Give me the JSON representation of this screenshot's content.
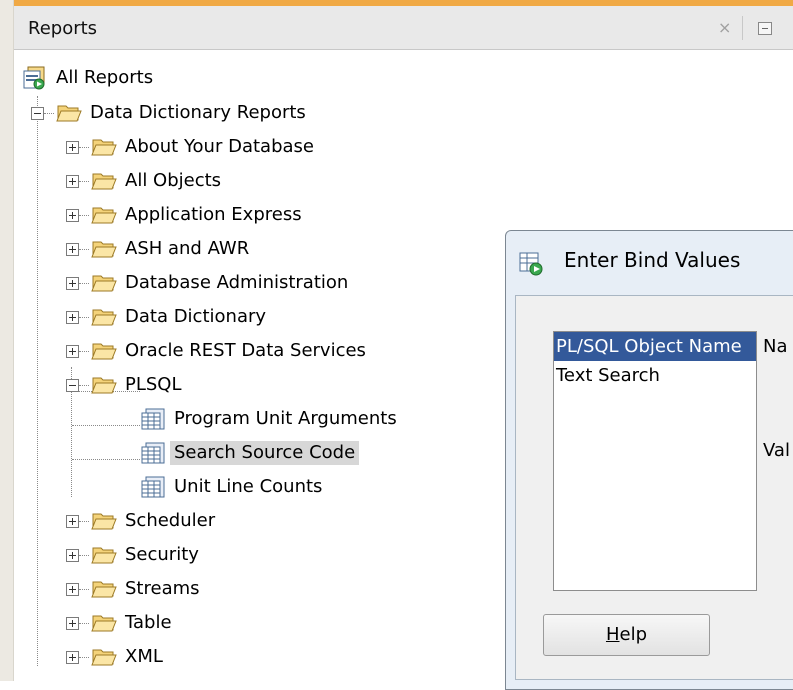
{
  "panel": {
    "title": "Reports",
    "close_glyph": "×",
    "accent_color": "#f0a945"
  },
  "tree": {
    "root": {
      "label": "All Reports",
      "icon": "reports-root-icon"
    },
    "group": {
      "label": "Data Dictionary Reports",
      "expanded": true
    },
    "folders": [
      {
        "label": "About Your Database",
        "expanded": false
      },
      {
        "label": "All Objects",
        "expanded": false
      },
      {
        "label": "Application Express",
        "expanded": false
      },
      {
        "label": "ASH and AWR",
        "expanded": false
      },
      {
        "label": "Database Administration",
        "expanded": false
      },
      {
        "label": "Data Dictionary",
        "expanded": false
      },
      {
        "label": "Oracle REST Data Services",
        "expanded": false
      },
      {
        "label": "PLSQL",
        "expanded": true
      },
      {
        "label": "Scheduler",
        "expanded": false
      },
      {
        "label": "Security",
        "expanded": false
      },
      {
        "label": "Streams",
        "expanded": false
      },
      {
        "label": "Table",
        "expanded": false
      },
      {
        "label": "XML",
        "expanded": false
      }
    ],
    "plsql_reports": [
      {
        "label": "Program Unit Arguments",
        "selected": false
      },
      {
        "label": "Search Source Code",
        "selected": true
      },
      {
        "label": "Unit Line Counts",
        "selected": false
      }
    ]
  },
  "dialog": {
    "title": "Enter Bind Values",
    "binds": [
      {
        "label": "PL/SQL Object Name",
        "selected": true
      },
      {
        "label": "Text Search",
        "selected": false
      }
    ],
    "name_label": "Na",
    "value_label": "Val",
    "help_button": {
      "mnemonic": "H",
      "rest": "elp"
    },
    "selection_color": "#33599a"
  }
}
